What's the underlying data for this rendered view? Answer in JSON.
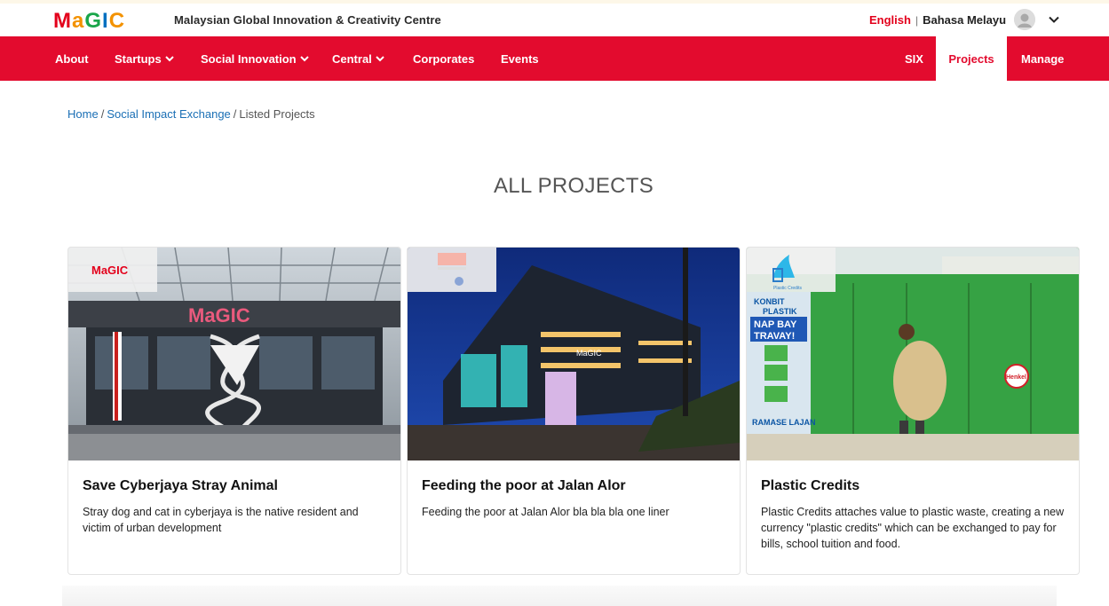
{
  "header": {
    "logo_text": "MaGIC",
    "site_name": "Malaysian Global Innovation & Creativity Centre",
    "lang_english": "English",
    "lang_separator": "|",
    "lang_malay": "Bahasa Melayu"
  },
  "nav": {
    "about": "About",
    "startups": "Startups",
    "social_innovation": "Social Innovation",
    "central": "Central",
    "corporates": "Corporates",
    "events": "Events",
    "six": "SIX",
    "projects": "Projects",
    "manage": "Manage"
  },
  "breadcrumb": {
    "home": "Home",
    "social_impact": "Social Impact Exchange",
    "current": "Listed Projects",
    "separator": "/"
  },
  "page_title": "ALL PROJECTS",
  "projects": [
    {
      "title": "Save Cyberjaya Stray Animal",
      "description": "Stray dog and cat in cyberjaya is the native resident and victim of urban development"
    },
    {
      "title": "Feeding the poor at Jalan Alor",
      "description": "Feeding the poor at Jalan Alor bla bla bla one liner"
    },
    {
      "title": "Plastic Credits",
      "description": "Plastic Credits attaches value to plastic waste, creating a new currency \"plastic credits\" which can be exchanged to pay for bills, school tuition and food."
    }
  ],
  "image_labels": {
    "building_sign": "MaGIC",
    "building_sign_2": "MaGIC",
    "sign_konbit": "KONBIT",
    "sign_plastik": "PLASTIK",
    "sign_nap_bay": "NAP BAY",
    "sign_travay": "TRAVAY!",
    "sign_ramase": "RAMASE LAJAN",
    "sign_henkel": "Henkel",
    "sign_plastic_credits": "Plastic Credits"
  },
  "colors": {
    "brand_red": "#e30b2e",
    "link_blue": "#1a6fb5"
  },
  "icons": {
    "caret": "chevron-down-icon",
    "avatar": "user-avatar-icon"
  }
}
